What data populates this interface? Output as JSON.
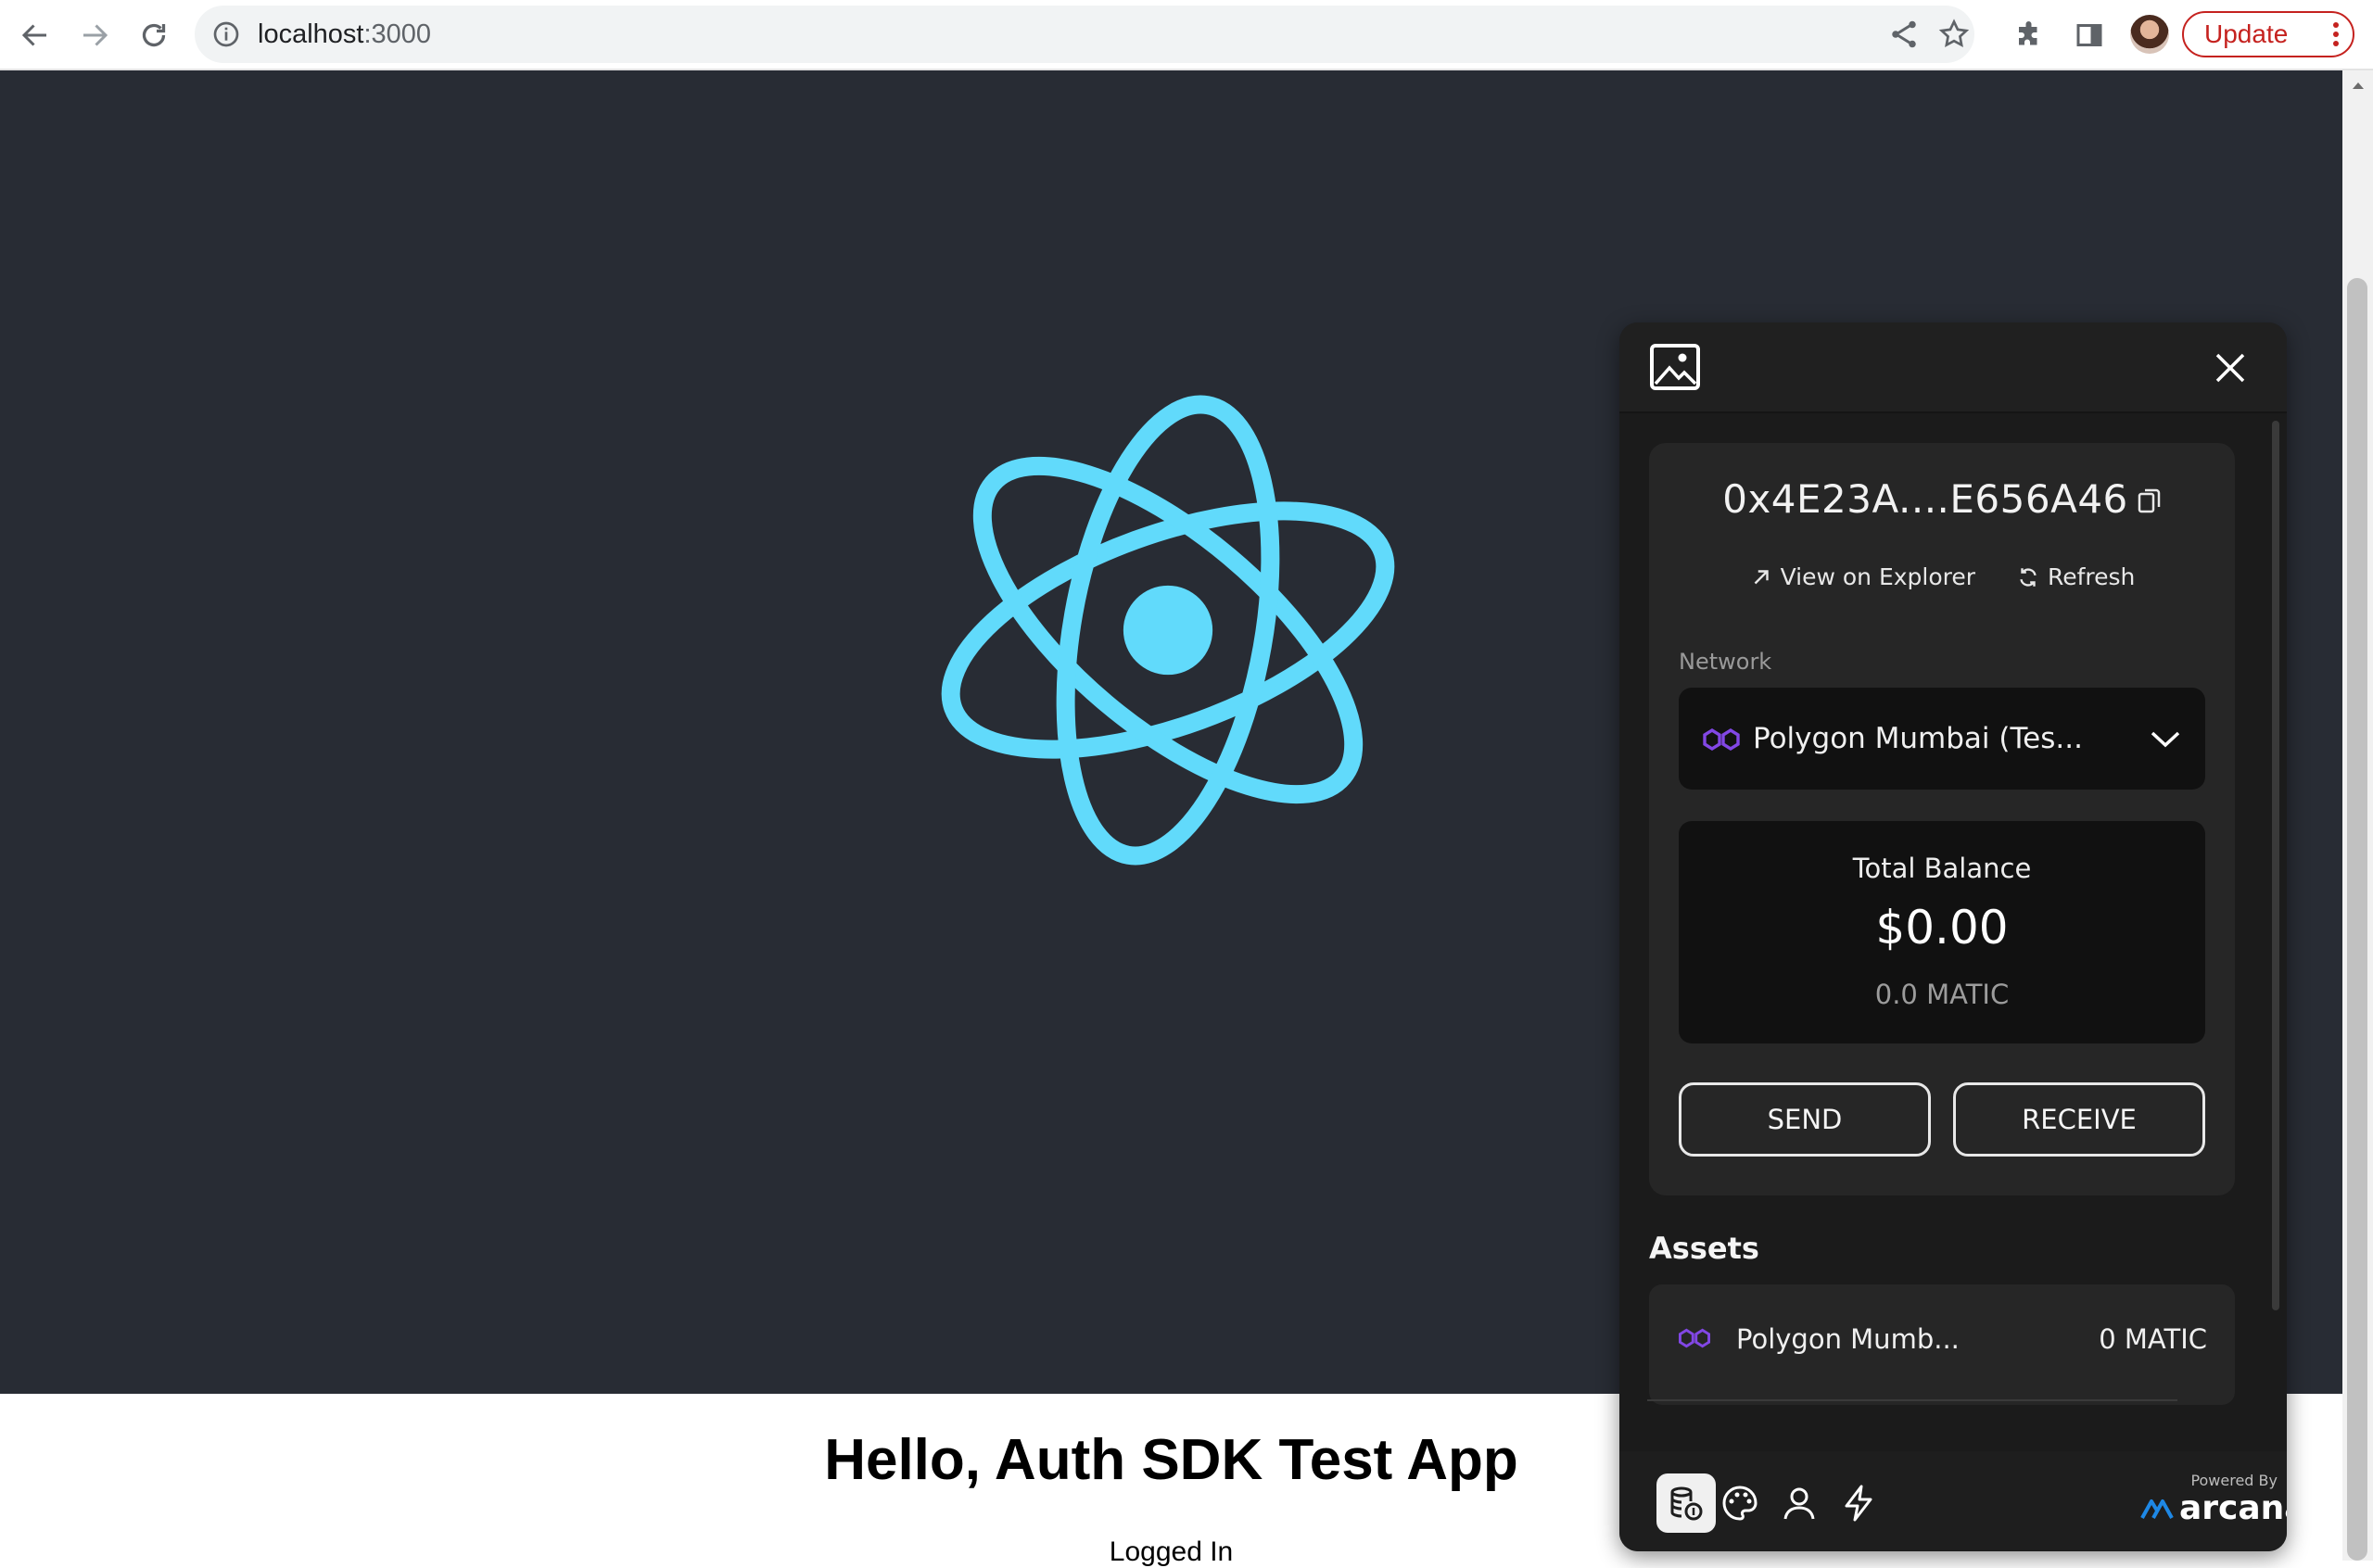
{
  "browser": {
    "url_host": "localhost",
    "url_port": ":3000",
    "update_label": "Update"
  },
  "page": {
    "title": "Hello, Auth SDK Test App",
    "status": "Logged In"
  },
  "wallet": {
    "address": "0x4E23A....E656A46",
    "view_explorer_label": "View on Explorer",
    "refresh_label": "Refresh",
    "network_label": "Network",
    "network_selected": "Polygon Mumbai (Tes...",
    "balance_label": "Total Balance",
    "balance_usd": "$0.00",
    "balance_token": "0.0 MATIC",
    "send_label": "SEND",
    "receive_label": "RECEIVE",
    "assets_title": "Assets",
    "assets": [
      {
        "name": "Polygon Mumb...",
        "amount": "0 MATIC"
      }
    ],
    "powered_by": "Powered By",
    "brand": "arcana"
  },
  "colors": {
    "header_bg": "#282c34",
    "react_blue": "#61dafb",
    "wallet_bg": "#1e1e1e",
    "polygon_purple": "#8247e5",
    "arcana_blue": "#1e88e5"
  },
  "icons": {
    "back": "arrow-left-icon",
    "forward": "arrow-right-icon",
    "reload": "reload-icon",
    "share": "share-icon",
    "bookmark": "star-icon",
    "extensions": "puzzle-icon",
    "sidepanel": "side-panel-icon",
    "wallet_logo": "image-icon",
    "close": "close-icon",
    "copy": "copy-icon",
    "explorer": "arrow-up-right-icon",
    "refresh": "refresh-icon",
    "network": "polygon-icon",
    "nav_assets": "coins-icon",
    "nav_nft": "palette-icon",
    "nav_profile": "user-icon",
    "nav_activity": "bolt-icon"
  }
}
